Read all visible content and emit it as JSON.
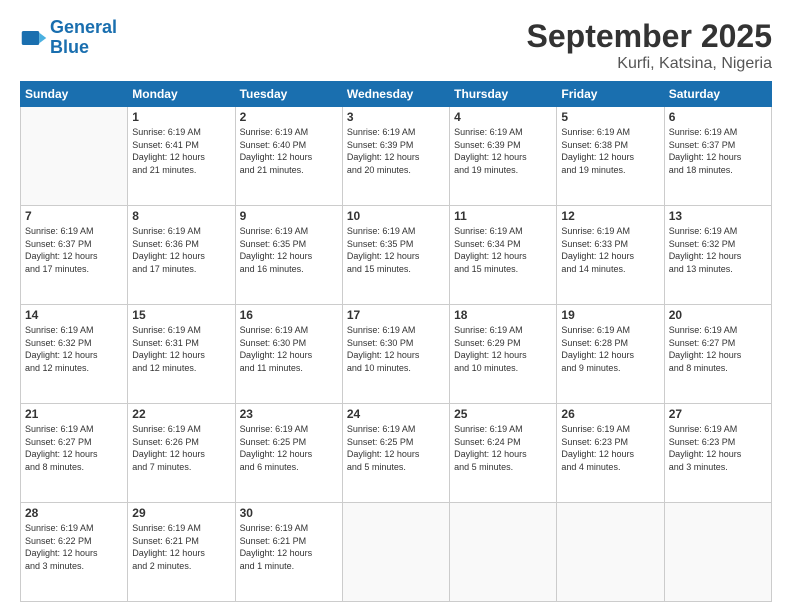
{
  "logo": {
    "line1": "General",
    "line2": "Blue"
  },
  "title": "September 2025",
  "location": "Kurfi, Katsina, Nigeria",
  "weekdays": [
    "Sunday",
    "Monday",
    "Tuesday",
    "Wednesday",
    "Thursday",
    "Friday",
    "Saturday"
  ],
  "weeks": [
    [
      {
        "day": null,
        "data": null
      },
      {
        "day": "1",
        "data": "Sunrise: 6:19 AM\nSunset: 6:41 PM\nDaylight: 12 hours\nand 21 minutes."
      },
      {
        "day": "2",
        "data": "Sunrise: 6:19 AM\nSunset: 6:40 PM\nDaylight: 12 hours\nand 21 minutes."
      },
      {
        "day": "3",
        "data": "Sunrise: 6:19 AM\nSunset: 6:39 PM\nDaylight: 12 hours\nand 20 minutes."
      },
      {
        "day": "4",
        "data": "Sunrise: 6:19 AM\nSunset: 6:39 PM\nDaylight: 12 hours\nand 19 minutes."
      },
      {
        "day": "5",
        "data": "Sunrise: 6:19 AM\nSunset: 6:38 PM\nDaylight: 12 hours\nand 19 minutes."
      },
      {
        "day": "6",
        "data": "Sunrise: 6:19 AM\nSunset: 6:37 PM\nDaylight: 12 hours\nand 18 minutes."
      }
    ],
    [
      {
        "day": "7",
        "data": "Sunrise: 6:19 AM\nSunset: 6:37 PM\nDaylight: 12 hours\nand 17 minutes."
      },
      {
        "day": "8",
        "data": "Sunrise: 6:19 AM\nSunset: 6:36 PM\nDaylight: 12 hours\nand 17 minutes."
      },
      {
        "day": "9",
        "data": "Sunrise: 6:19 AM\nSunset: 6:35 PM\nDaylight: 12 hours\nand 16 minutes."
      },
      {
        "day": "10",
        "data": "Sunrise: 6:19 AM\nSunset: 6:35 PM\nDaylight: 12 hours\nand 15 minutes."
      },
      {
        "day": "11",
        "data": "Sunrise: 6:19 AM\nSunset: 6:34 PM\nDaylight: 12 hours\nand 15 minutes."
      },
      {
        "day": "12",
        "data": "Sunrise: 6:19 AM\nSunset: 6:33 PM\nDaylight: 12 hours\nand 14 minutes."
      },
      {
        "day": "13",
        "data": "Sunrise: 6:19 AM\nSunset: 6:32 PM\nDaylight: 12 hours\nand 13 minutes."
      }
    ],
    [
      {
        "day": "14",
        "data": "Sunrise: 6:19 AM\nSunset: 6:32 PM\nDaylight: 12 hours\nand 12 minutes."
      },
      {
        "day": "15",
        "data": "Sunrise: 6:19 AM\nSunset: 6:31 PM\nDaylight: 12 hours\nand 12 minutes."
      },
      {
        "day": "16",
        "data": "Sunrise: 6:19 AM\nSunset: 6:30 PM\nDaylight: 12 hours\nand 11 minutes."
      },
      {
        "day": "17",
        "data": "Sunrise: 6:19 AM\nSunset: 6:30 PM\nDaylight: 12 hours\nand 10 minutes."
      },
      {
        "day": "18",
        "data": "Sunrise: 6:19 AM\nSunset: 6:29 PM\nDaylight: 12 hours\nand 10 minutes."
      },
      {
        "day": "19",
        "data": "Sunrise: 6:19 AM\nSunset: 6:28 PM\nDaylight: 12 hours\nand 9 minutes."
      },
      {
        "day": "20",
        "data": "Sunrise: 6:19 AM\nSunset: 6:27 PM\nDaylight: 12 hours\nand 8 minutes."
      }
    ],
    [
      {
        "day": "21",
        "data": "Sunrise: 6:19 AM\nSunset: 6:27 PM\nDaylight: 12 hours\nand 8 minutes."
      },
      {
        "day": "22",
        "data": "Sunrise: 6:19 AM\nSunset: 6:26 PM\nDaylight: 12 hours\nand 7 minutes."
      },
      {
        "day": "23",
        "data": "Sunrise: 6:19 AM\nSunset: 6:25 PM\nDaylight: 12 hours\nand 6 minutes."
      },
      {
        "day": "24",
        "data": "Sunrise: 6:19 AM\nSunset: 6:25 PM\nDaylight: 12 hours\nand 5 minutes."
      },
      {
        "day": "25",
        "data": "Sunrise: 6:19 AM\nSunset: 6:24 PM\nDaylight: 12 hours\nand 5 minutes."
      },
      {
        "day": "26",
        "data": "Sunrise: 6:19 AM\nSunset: 6:23 PM\nDaylight: 12 hours\nand 4 minutes."
      },
      {
        "day": "27",
        "data": "Sunrise: 6:19 AM\nSunset: 6:23 PM\nDaylight: 12 hours\nand 3 minutes."
      }
    ],
    [
      {
        "day": "28",
        "data": "Sunrise: 6:19 AM\nSunset: 6:22 PM\nDaylight: 12 hours\nand 3 minutes."
      },
      {
        "day": "29",
        "data": "Sunrise: 6:19 AM\nSunset: 6:21 PM\nDaylight: 12 hours\nand 2 minutes."
      },
      {
        "day": "30",
        "data": "Sunrise: 6:19 AM\nSunset: 6:21 PM\nDaylight: 12 hours\nand 1 minute."
      },
      {
        "day": null,
        "data": null
      },
      {
        "day": null,
        "data": null
      },
      {
        "day": null,
        "data": null
      },
      {
        "day": null,
        "data": null
      }
    ]
  ]
}
